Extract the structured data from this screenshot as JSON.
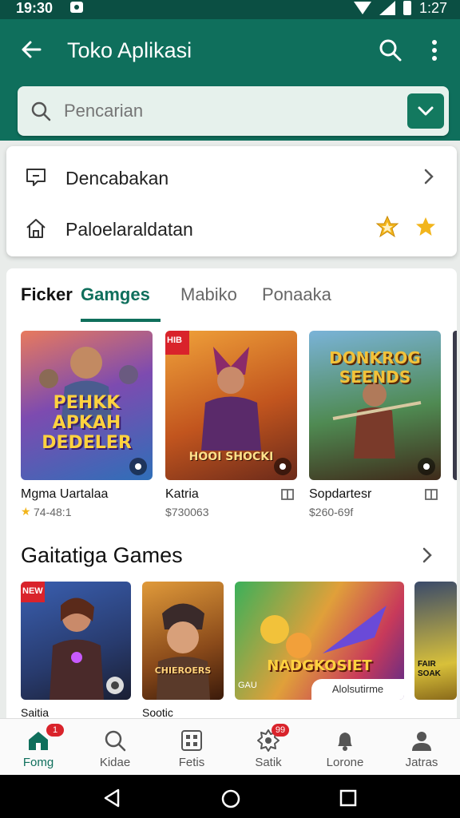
{
  "status_bar": {
    "time": "19:30",
    "right_time": "1:27"
  },
  "app_bar": {
    "title": "Toko Aplikasi"
  },
  "search": {
    "value": "",
    "placeholder": "Pencarian"
  },
  "dropdown": {
    "items": [
      {
        "label": "Dencabakan",
        "icon": "comment-icon",
        "trailing": "chevron"
      },
      {
        "label": "Paloelaraldatan",
        "icon": "home-icon",
        "trailing": "stars"
      }
    ]
  },
  "tabs": {
    "items": [
      {
        "label": "Ficker",
        "active": false
      },
      {
        "label": "Gamges",
        "active": true
      },
      {
        "label": "Mabiko",
        "active": false
      },
      {
        "label": "Ponaaka",
        "active": false
      }
    ]
  },
  "featured_games": [
    {
      "title_art": "PEHKK APKAH DEDELER",
      "name": "Mgma Uartalaa",
      "meta": "74-48:1",
      "rating": true
    },
    {
      "title_art": "HOOI SHOCKI",
      "name": "Katria",
      "meta": "$730063",
      "tag": "HIB"
    },
    {
      "title_art": "DONKROG SEENDS",
      "name": "Sopdartesr",
      "meta": "$260-69f"
    }
  ],
  "section": {
    "title": "Gaitatiga Games"
  },
  "section_games": [
    {
      "name": "Saitia",
      "tag": "NEW"
    },
    {
      "name": "Sootic",
      "title_art": "CHIEROERS"
    },
    {
      "title_art": "NADGKOSIET",
      "overlay": "Alolsutirme",
      "subtitle": "GAU"
    },
    {
      "title_art": "FAIR SOAK"
    }
  ],
  "bottom_nav": {
    "items": [
      {
        "label": "Fomg",
        "icon": "home-icon",
        "badge": "1",
        "active": true
      },
      {
        "label": "Kidae",
        "icon": "search-icon"
      },
      {
        "label": "Fetis",
        "icon": "grid-icon"
      },
      {
        "label": "Satik",
        "icon": "gear-icon",
        "badge": "99"
      },
      {
        "label": "Lorone",
        "icon": "bell-icon"
      },
      {
        "label": "Jatras",
        "icon": "person-icon"
      }
    ]
  },
  "colors": {
    "primary": "#0f6f5c",
    "dark": "#0b4f43",
    "accent": "#d9232b",
    "star": "#f2b51c"
  }
}
